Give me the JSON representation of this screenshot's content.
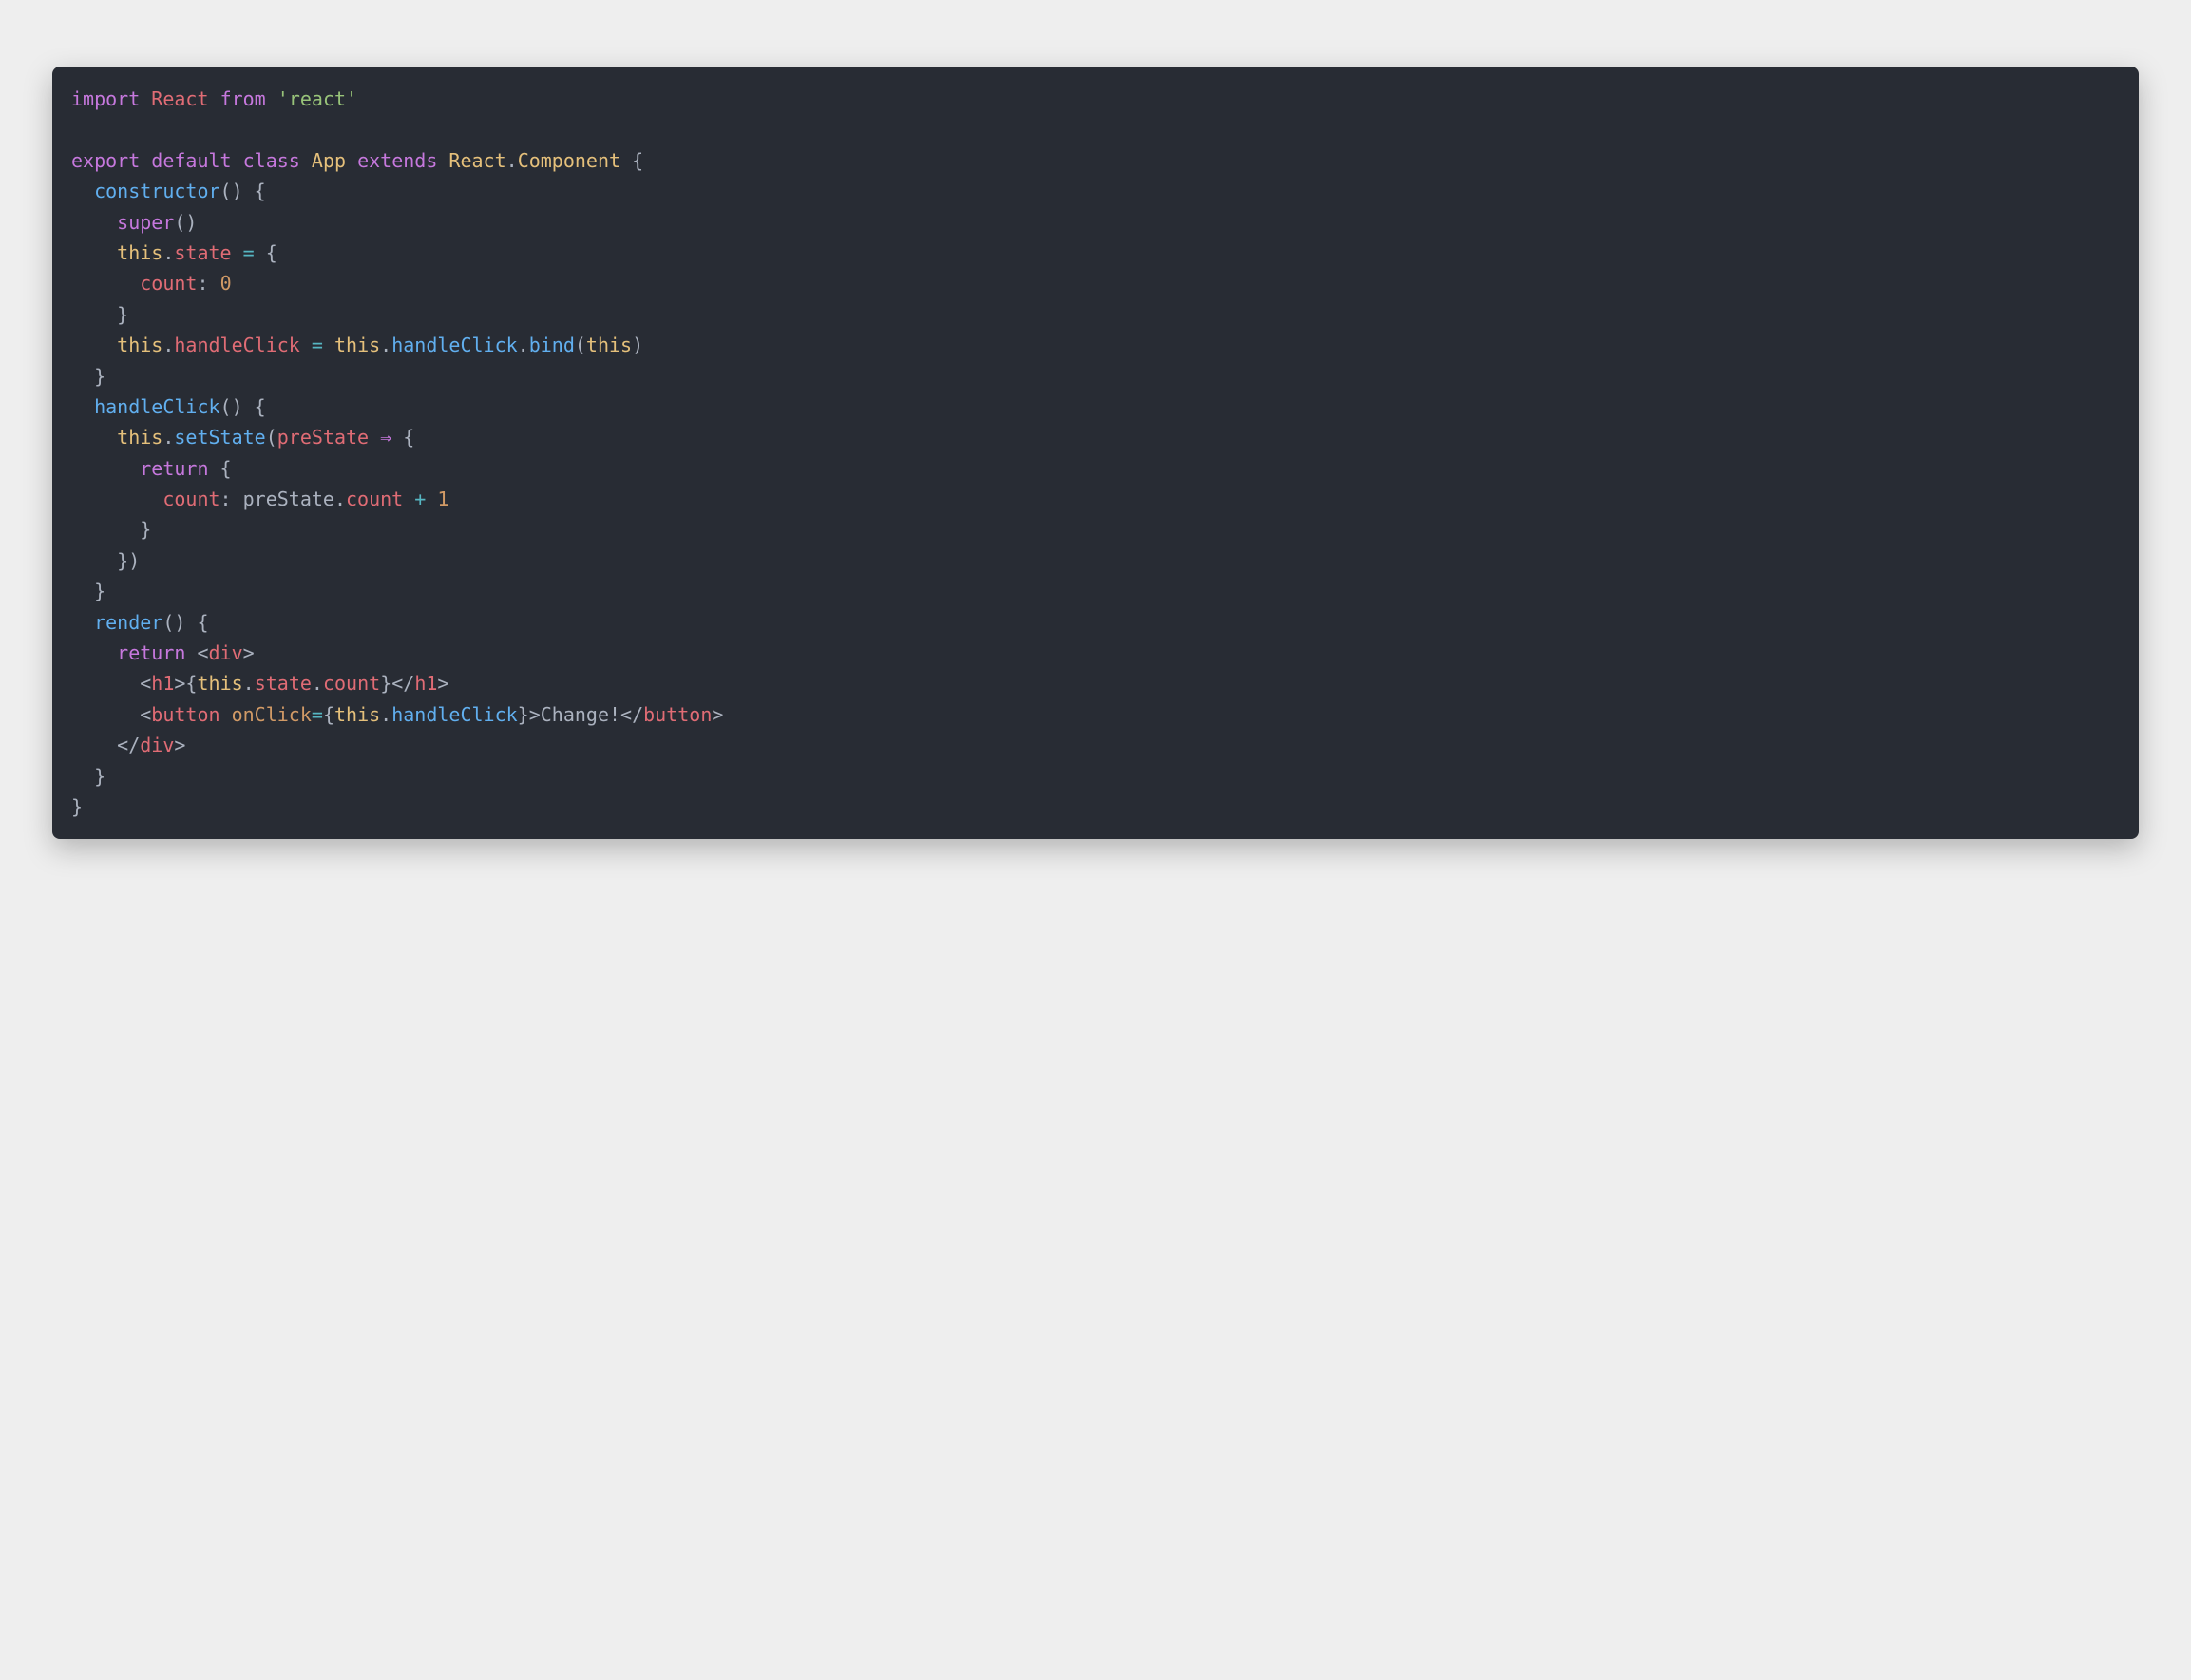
{
  "code": {
    "lines": [
      [
        {
          "text": "import",
          "cls": "c-keyword"
        },
        {
          "text": " ",
          "cls": "c-default"
        },
        {
          "text": "React",
          "cls": "c-prop"
        },
        {
          "text": " ",
          "cls": "c-default"
        },
        {
          "text": "from",
          "cls": "c-keyword"
        },
        {
          "text": " ",
          "cls": "c-default"
        },
        {
          "text": "'react'",
          "cls": "c-string"
        }
      ],
      [],
      [
        {
          "text": "export",
          "cls": "c-keyword"
        },
        {
          "text": " ",
          "cls": "c-default"
        },
        {
          "text": "default",
          "cls": "c-keyword"
        },
        {
          "text": " ",
          "cls": "c-default"
        },
        {
          "text": "class",
          "cls": "c-keyword"
        },
        {
          "text": " ",
          "cls": "c-default"
        },
        {
          "text": "App",
          "cls": "c-comp"
        },
        {
          "text": " ",
          "cls": "c-default"
        },
        {
          "text": "extends",
          "cls": "c-keyword"
        },
        {
          "text": " ",
          "cls": "c-default"
        },
        {
          "text": "React",
          "cls": "c-comp"
        },
        {
          "text": ".",
          "cls": "c-default"
        },
        {
          "text": "Component",
          "cls": "c-comp"
        },
        {
          "text": " {",
          "cls": "c-default"
        }
      ],
      [
        {
          "text": "  ",
          "cls": "c-default"
        },
        {
          "text": "constructor",
          "cls": "c-func"
        },
        {
          "text": "() {",
          "cls": "c-default"
        }
      ],
      [
        {
          "text": "    ",
          "cls": "c-default"
        },
        {
          "text": "super",
          "cls": "c-keyword"
        },
        {
          "text": "()",
          "cls": "c-default"
        }
      ],
      [
        {
          "text": "    ",
          "cls": "c-default"
        },
        {
          "text": "this",
          "cls": "c-this"
        },
        {
          "text": ".",
          "cls": "c-default"
        },
        {
          "text": "state",
          "cls": "c-prop"
        },
        {
          "text": " ",
          "cls": "c-default"
        },
        {
          "text": "=",
          "cls": "c-operator"
        },
        {
          "text": " {",
          "cls": "c-default"
        }
      ],
      [
        {
          "text": "      ",
          "cls": "c-default"
        },
        {
          "text": "count",
          "cls": "c-prop"
        },
        {
          "text": ": ",
          "cls": "c-default"
        },
        {
          "text": "0",
          "cls": "c-num"
        }
      ],
      [
        {
          "text": "    }",
          "cls": "c-default"
        }
      ],
      [
        {
          "text": "    ",
          "cls": "c-default"
        },
        {
          "text": "this",
          "cls": "c-this"
        },
        {
          "text": ".",
          "cls": "c-default"
        },
        {
          "text": "handleClick",
          "cls": "c-prop"
        },
        {
          "text": " ",
          "cls": "c-default"
        },
        {
          "text": "=",
          "cls": "c-operator"
        },
        {
          "text": " ",
          "cls": "c-default"
        },
        {
          "text": "this",
          "cls": "c-this"
        },
        {
          "text": ".",
          "cls": "c-default"
        },
        {
          "text": "handleClick",
          "cls": "c-func"
        },
        {
          "text": ".",
          "cls": "c-default"
        },
        {
          "text": "bind",
          "cls": "c-func"
        },
        {
          "text": "(",
          "cls": "c-default"
        },
        {
          "text": "this",
          "cls": "c-this"
        },
        {
          "text": ")",
          "cls": "c-default"
        }
      ],
      [
        {
          "text": "  }",
          "cls": "c-default"
        }
      ],
      [
        {
          "text": "  ",
          "cls": "c-default"
        },
        {
          "text": "handleClick",
          "cls": "c-func"
        },
        {
          "text": "() {",
          "cls": "c-default"
        }
      ],
      [
        {
          "text": "    ",
          "cls": "c-default"
        },
        {
          "text": "this",
          "cls": "c-this"
        },
        {
          "text": ".",
          "cls": "c-default"
        },
        {
          "text": "setState",
          "cls": "c-func"
        },
        {
          "text": "(",
          "cls": "c-default"
        },
        {
          "text": "preState",
          "cls": "c-prop"
        },
        {
          "text": " ",
          "cls": "c-default"
        },
        {
          "text": "⇒",
          "cls": "c-arrow"
        },
        {
          "text": " {",
          "cls": "c-default"
        }
      ],
      [
        {
          "text": "      ",
          "cls": "c-default"
        },
        {
          "text": "return",
          "cls": "c-keyword"
        },
        {
          "text": " {",
          "cls": "c-default"
        }
      ],
      [
        {
          "text": "        ",
          "cls": "c-default"
        },
        {
          "text": "count",
          "cls": "c-prop"
        },
        {
          "text": ": ",
          "cls": "c-default"
        },
        {
          "text": "preState",
          "cls": "c-default"
        },
        {
          "text": ".",
          "cls": "c-default"
        },
        {
          "text": "count",
          "cls": "c-prop"
        },
        {
          "text": " ",
          "cls": "c-default"
        },
        {
          "text": "+",
          "cls": "c-operator"
        },
        {
          "text": " ",
          "cls": "c-default"
        },
        {
          "text": "1",
          "cls": "c-num"
        }
      ],
      [
        {
          "text": "      }",
          "cls": "c-default"
        }
      ],
      [
        {
          "text": "    })",
          "cls": "c-default"
        }
      ],
      [
        {
          "text": "  }",
          "cls": "c-default"
        }
      ],
      [
        {
          "text": "  ",
          "cls": "c-default"
        },
        {
          "text": "render",
          "cls": "c-func"
        },
        {
          "text": "() {",
          "cls": "c-default"
        }
      ],
      [
        {
          "text": "    ",
          "cls": "c-default"
        },
        {
          "text": "return",
          "cls": "c-keyword"
        },
        {
          "text": " <",
          "cls": "c-default"
        },
        {
          "text": "div",
          "cls": "c-prop"
        },
        {
          "text": ">",
          "cls": "c-default"
        }
      ],
      [
        {
          "text": "      <",
          "cls": "c-default"
        },
        {
          "text": "h1",
          "cls": "c-prop"
        },
        {
          "text": ">{",
          "cls": "c-default"
        },
        {
          "text": "this",
          "cls": "c-this"
        },
        {
          "text": ".",
          "cls": "c-default"
        },
        {
          "text": "state",
          "cls": "c-prop"
        },
        {
          "text": ".",
          "cls": "c-default"
        },
        {
          "text": "count",
          "cls": "c-prop"
        },
        {
          "text": "}</",
          "cls": "c-default"
        },
        {
          "text": "h1",
          "cls": "c-prop"
        },
        {
          "text": ">",
          "cls": "c-default"
        }
      ],
      [
        {
          "text": "      <",
          "cls": "c-default"
        },
        {
          "text": "button",
          "cls": "c-prop"
        },
        {
          "text": " ",
          "cls": "c-default"
        },
        {
          "text": "onClick",
          "cls": "c-attr"
        },
        {
          "text": "=",
          "cls": "c-operator"
        },
        {
          "text": "{",
          "cls": "c-default"
        },
        {
          "text": "this",
          "cls": "c-this"
        },
        {
          "text": ".",
          "cls": "c-default"
        },
        {
          "text": "handleClick",
          "cls": "c-func"
        },
        {
          "text": "}>",
          "cls": "c-default"
        },
        {
          "text": "Change!",
          "cls": "c-default"
        },
        {
          "text": "</",
          "cls": "c-default"
        },
        {
          "text": "button",
          "cls": "c-prop"
        },
        {
          "text": ">",
          "cls": "c-default"
        }
      ],
      [
        {
          "text": "    </",
          "cls": "c-default"
        },
        {
          "text": "div",
          "cls": "c-prop"
        },
        {
          "text": ">",
          "cls": "c-default"
        }
      ],
      [
        {
          "text": "  }",
          "cls": "c-default"
        }
      ],
      [
        {
          "text": "}",
          "cls": "c-default"
        }
      ]
    ]
  }
}
